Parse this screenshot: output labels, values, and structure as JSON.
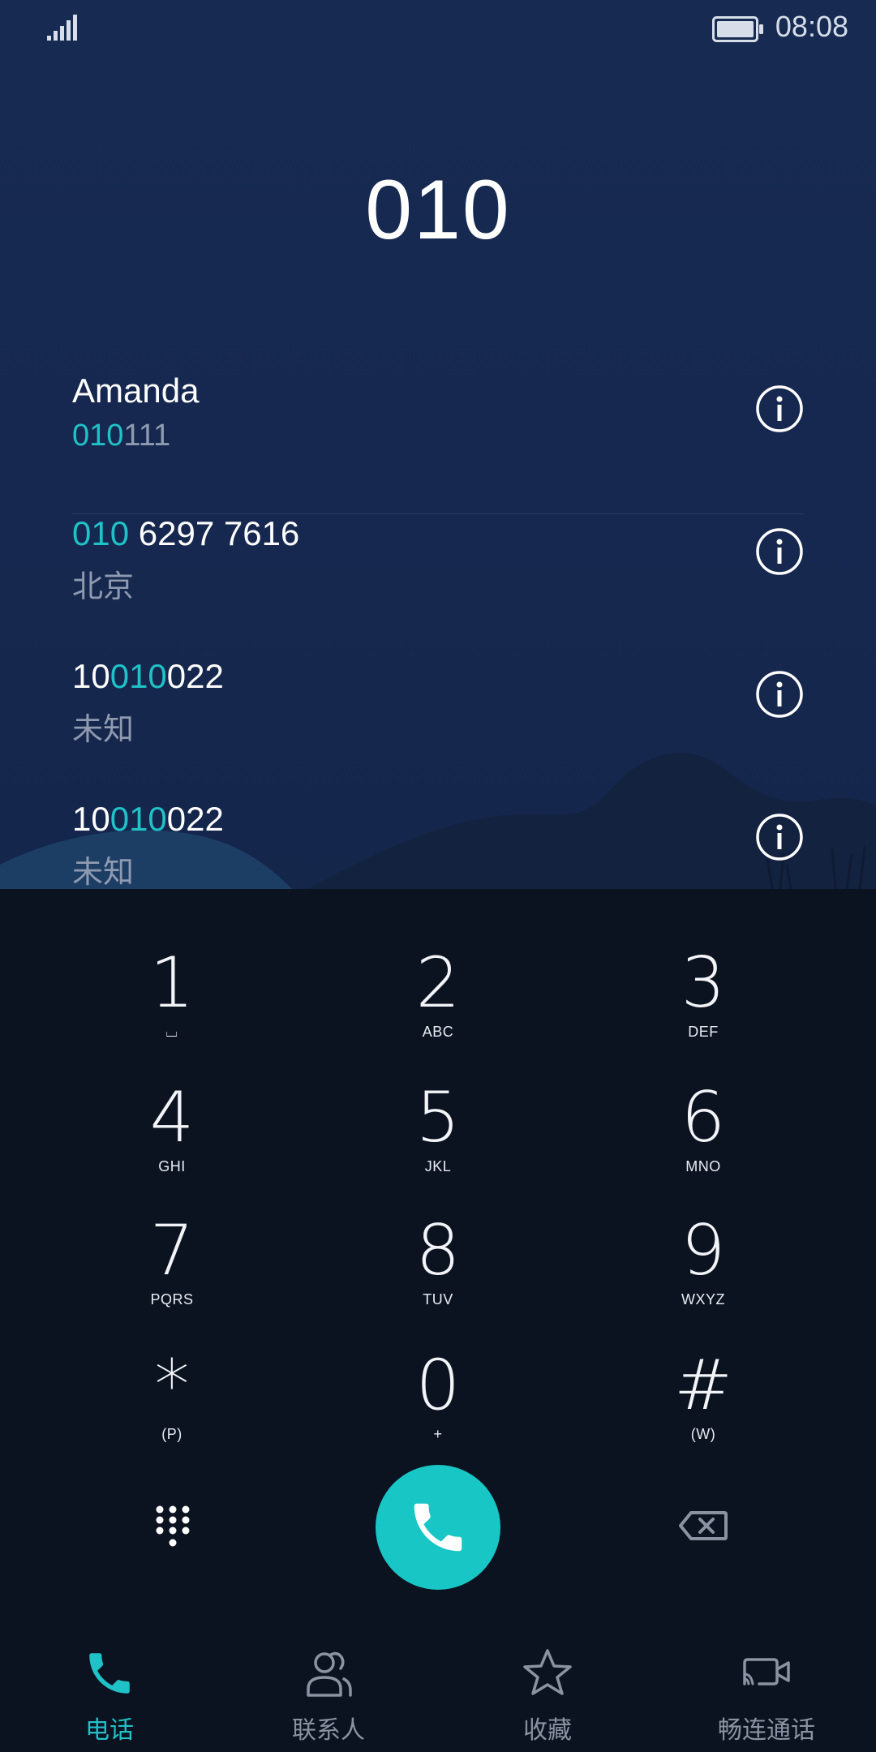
{
  "status_bar": {
    "time": "08:08"
  },
  "dialed_number": "010",
  "results": [
    {
      "line1_parts": [
        {
          "t": "Amanda",
          "h": false
        }
      ],
      "line2_parts": [
        {
          "t": "010",
          "h": true
        },
        {
          "t": "111",
          "h": false
        }
      ]
    },
    {
      "line1_parts": [
        {
          "t": "010",
          "h": true
        },
        {
          "t": " 6297 7616",
          "h": false
        }
      ],
      "line2_parts": [
        {
          "t": "北京",
          "h": false
        }
      ]
    },
    {
      "line1_parts": [
        {
          "t": "10",
          "h": false
        },
        {
          "t": "010",
          "h": true
        },
        {
          "t": "022",
          "h": false
        }
      ],
      "line2_parts": [
        {
          "t": "未知",
          "h": false
        }
      ]
    },
    {
      "line1_parts": [
        {
          "t": "10",
          "h": false
        },
        {
          "t": "010",
          "h": true
        },
        {
          "t": "022",
          "h": false
        }
      ],
      "line2_parts": [
        {
          "t": "未知",
          "h": false
        }
      ]
    }
  ],
  "keypad": [
    {
      "digit": "1",
      "letters": "⌴"
    },
    {
      "digit": "2",
      "letters": "ABC"
    },
    {
      "digit": "3",
      "letters": "DEF"
    },
    {
      "digit": "4",
      "letters": "GHI"
    },
    {
      "digit": "5",
      "letters": "JKL"
    },
    {
      "digit": "6",
      "letters": "MNO"
    },
    {
      "digit": "7",
      "letters": "PQRS"
    },
    {
      "digit": "8",
      "letters": "TUV"
    },
    {
      "digit": "9",
      "letters": "WXYZ"
    },
    {
      "digit": "*",
      "letters": "(P)"
    },
    {
      "digit": "0",
      "letters": "+"
    },
    {
      "digit": "#",
      "letters": "(W)"
    }
  ],
  "tabs": [
    {
      "label": "电话",
      "icon": "phone-icon",
      "active": true
    },
    {
      "label": "联系人",
      "icon": "contacts-icon",
      "active": false
    },
    {
      "label": "收藏",
      "icon": "star-icon",
      "active": false
    },
    {
      "label": "畅连通话",
      "icon": "video-call-icon",
      "active": false
    }
  ],
  "colors": {
    "accent": "#1fc2c7",
    "bg_top": "#172a52",
    "bg_pad": "#0c1320"
  }
}
